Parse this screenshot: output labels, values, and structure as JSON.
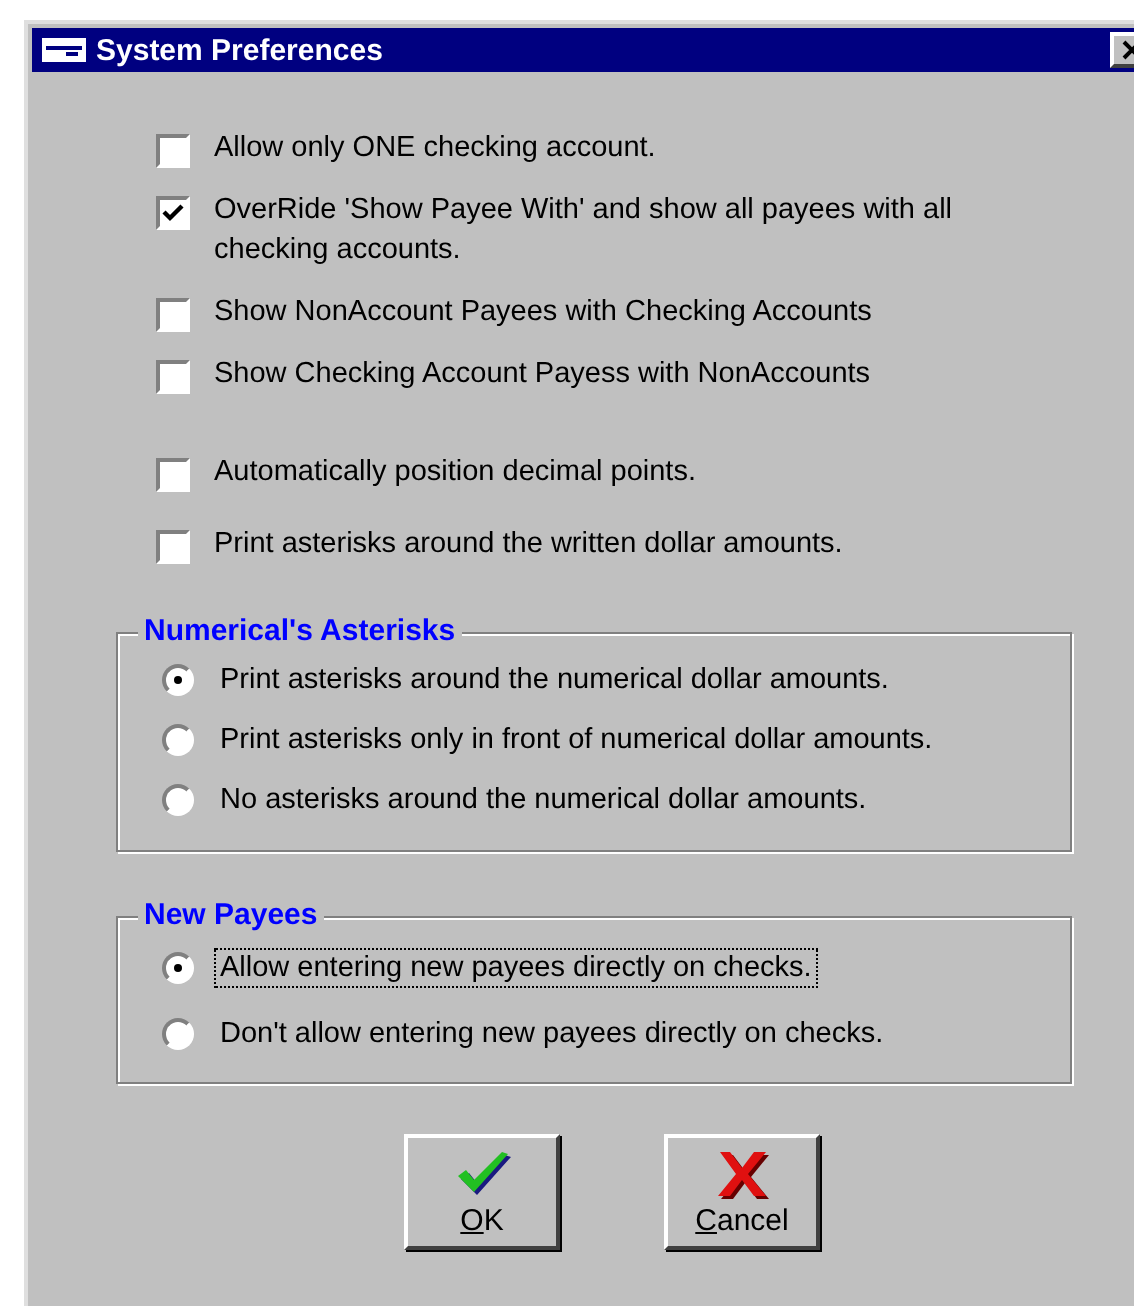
{
  "window": {
    "title": "System Preferences"
  },
  "account_options": [
    {
      "label": "Allow only ONE checking account.",
      "checked": false
    },
    {
      "label": "OverRide 'Show Payee With' and show all payees with all checking accounts.",
      "checked": true
    },
    {
      "label": "Show NonAccount Payees with Checking Accounts",
      "checked": false
    },
    {
      "label": "Show Checking Account Payess with NonAccounts",
      "checked": false
    }
  ],
  "amount_options": [
    {
      "label": "Automatically position decimal points.",
      "checked": false
    },
    {
      "label": "Print asterisks around the written dollar amounts.",
      "checked": false
    }
  ],
  "groups": [
    {
      "title": "Numerical's Asterisks",
      "options": [
        {
          "label": "Print asterisks around the numerical dollar amounts.",
          "selected": true,
          "focused": false
        },
        {
          "label": "Print asterisks only in front of numerical dollar amounts.",
          "selected": false,
          "focused": false
        },
        {
          "label": "No asterisks around the numerical dollar amounts.",
          "selected": false,
          "focused": false
        }
      ]
    },
    {
      "title": "New Payees",
      "options": [
        {
          "label": "Allow entering new payees directly on checks.",
          "selected": true,
          "focused": true
        },
        {
          "label": "Don't allow entering new payees directly on checks.",
          "selected": false,
          "focused": false
        }
      ]
    }
  ],
  "buttons": [
    {
      "label": "OK",
      "kind": "ok"
    },
    {
      "label": "Cancel",
      "kind": "cancel"
    }
  ]
}
